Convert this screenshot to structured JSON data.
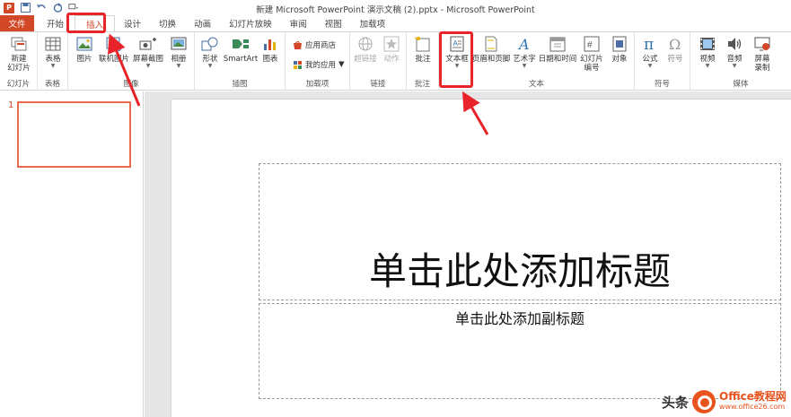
{
  "window": {
    "title": "新建 Microsoft PowerPoint 演示文稿 (2).pptx - Microsoft PowerPoint"
  },
  "qat": {
    "app_logo": "P",
    "icons": [
      "save-icon",
      "undo-icon",
      "redo-icon",
      "customize-icon"
    ]
  },
  "tabs": [
    {
      "label": "文件",
      "kind": "file"
    },
    {
      "label": "开始"
    },
    {
      "label": "插入",
      "active": true
    },
    {
      "label": "设计"
    },
    {
      "label": "切换"
    },
    {
      "label": "动画"
    },
    {
      "label": "幻灯片放映"
    },
    {
      "label": "审阅"
    },
    {
      "label": "视图"
    },
    {
      "label": "加载项"
    }
  ],
  "ribbon": {
    "groups": {
      "slides": "幻灯片",
      "tables": "表格",
      "images": "图像",
      "illustrations": "插图",
      "addins": "加载项",
      "links": "链接",
      "comments": "批注",
      "text": "文本",
      "symbols": "符号",
      "media": "媒体"
    },
    "buttons": {
      "new_slide": "新建\n幻灯片",
      "table": "表格",
      "picture": "图片",
      "online_pictures": "联机图片",
      "screenshot": "屏幕截图",
      "album": "相册",
      "shapes": "形状",
      "smartart": "SmartArt",
      "chart": "图表",
      "store": "应用商店",
      "my_apps": "我的应用",
      "hyperlink": "超链接",
      "action": "动作",
      "comment": "批注",
      "textbox": "文本框",
      "header_footer": "页眉和页脚",
      "wordart": "艺术字",
      "date_time": "日期和时间",
      "slide_number": "幻灯片\n编号",
      "object": "对象",
      "equation": "公式",
      "symbol": "符号",
      "video": "视频",
      "audio": "音频",
      "screen_record": "屏幕\n录制"
    }
  },
  "slides": {
    "thumb_number": "1"
  },
  "slide": {
    "title_placeholder": "单击此处添加标题",
    "subtitle_placeholder": "单击此处添加副标题"
  },
  "watermark": {
    "head": "头条",
    "brand": "Office教程网",
    "url": "www.office26.com"
  },
  "colors": {
    "accent": "#d24726",
    "annotation": "#e8232a"
  }
}
